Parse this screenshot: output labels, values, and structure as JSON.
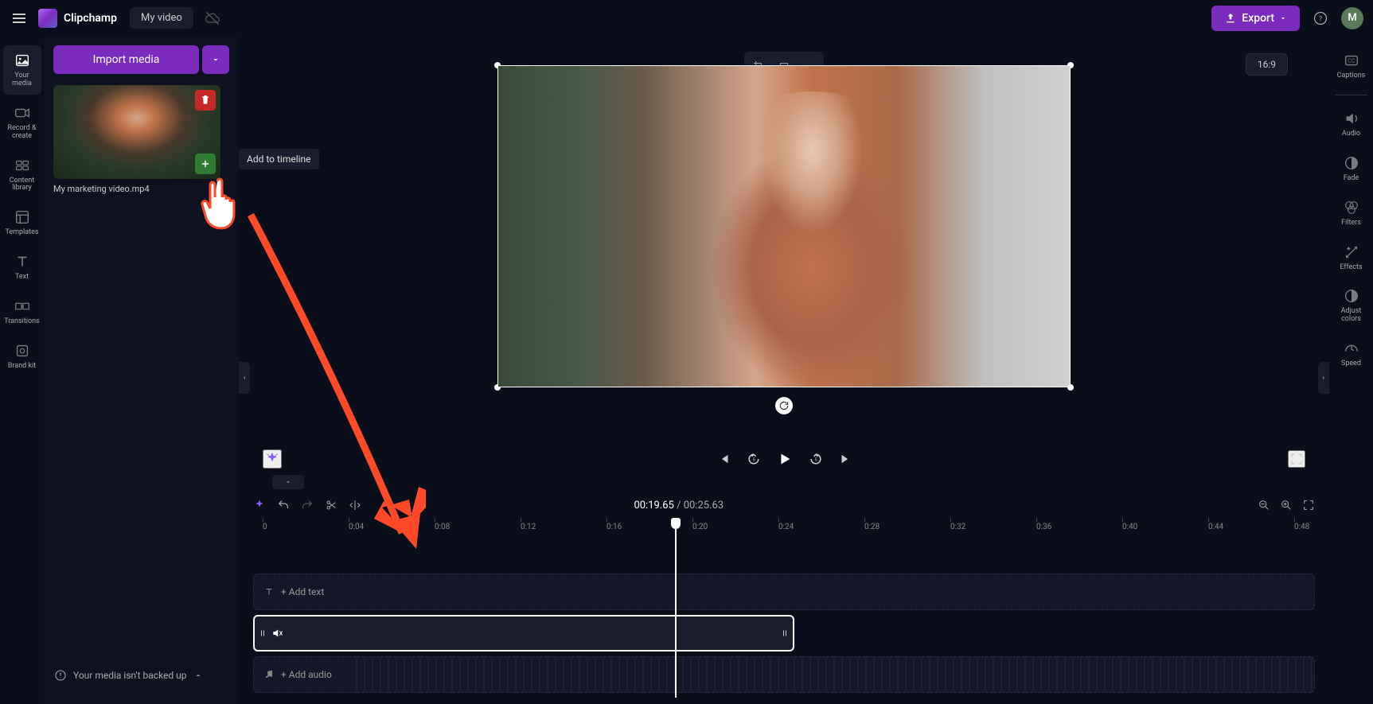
{
  "app": {
    "name": "Clipchamp",
    "title": "My video"
  },
  "topbar": {
    "export_label": "Export",
    "avatar_letter": "M"
  },
  "left_rail": [
    {
      "label": "Your media"
    },
    {
      "label": "Record & create"
    },
    {
      "label": "Content library"
    },
    {
      "label": "Templates"
    },
    {
      "label": "Text"
    },
    {
      "label": "Transitions"
    },
    {
      "label": "Brand kit"
    }
  ],
  "media_panel": {
    "import_label": "Import media",
    "thumb_name": "My marketing video.mp4",
    "add_tooltip": "Add to timeline"
  },
  "preview": {
    "aspect_label": "16:9"
  },
  "playback": {
    "current_time": "00:19.65",
    "total_time": "00:25.63"
  },
  "timeline": {
    "ticks": [
      "0",
      "0:04",
      "0:08",
      "0:12",
      "0:16",
      "0:20",
      "0:24",
      "0:28",
      "0:32",
      "0:36",
      "0:40",
      "0:44",
      "0:48"
    ],
    "add_text_label": "+ Add text",
    "add_audio_label": "+ Add audio"
  },
  "right_rail": [
    {
      "label": "Captions"
    },
    {
      "label": "Audio"
    },
    {
      "label": "Fade"
    },
    {
      "label": "Filters"
    },
    {
      "label": "Effects"
    },
    {
      "label": "Adjust colors"
    },
    {
      "label": "Speed"
    }
  ],
  "status": {
    "backup_msg": "Your media isn't backed up"
  }
}
